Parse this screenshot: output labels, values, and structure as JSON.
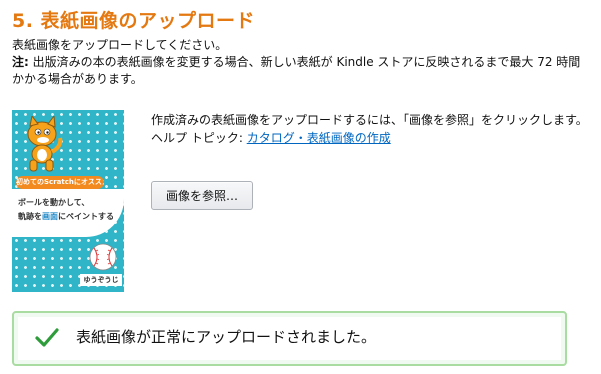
{
  "section": {
    "title": "5. 表紙画像のアップロード",
    "intro": "表紙画像をアップロードしてください。",
    "note_label": "注:",
    "note_text": " 出版済みの本の表紙画像を変更する場合、新しい表紙が Kindle ストアに反映されるまで最大 72 時間かかる場合があります。"
  },
  "cover": {
    "badge": "初めてのScratchにオススメ!",
    "line1": "ボールを動かして、",
    "line2_a": "軌跡を",
    "line2_b": "画面",
    "line2_c": "にペイントする",
    "author": "ゆうぞうじ",
    "colors": {
      "background": "#2fb5c7",
      "badge": "#f28a20",
      "highlight": "#1e88c7"
    }
  },
  "upload": {
    "instruction": "作成済みの表紙画像をアップロードするには、「画像を参照」をクリックします。",
    "help_prefix": "ヘルプ トピック: ",
    "help_link": "カタログ・表紙画像の作成",
    "browse_button": "画像を参照…"
  },
  "status": {
    "icon": "checkmark-icon",
    "message": "表紙画像が正常にアップロードされました。",
    "color": "#2e9c3a"
  },
  "accent_color": "#e47911",
  "link_color": "#0066c0"
}
